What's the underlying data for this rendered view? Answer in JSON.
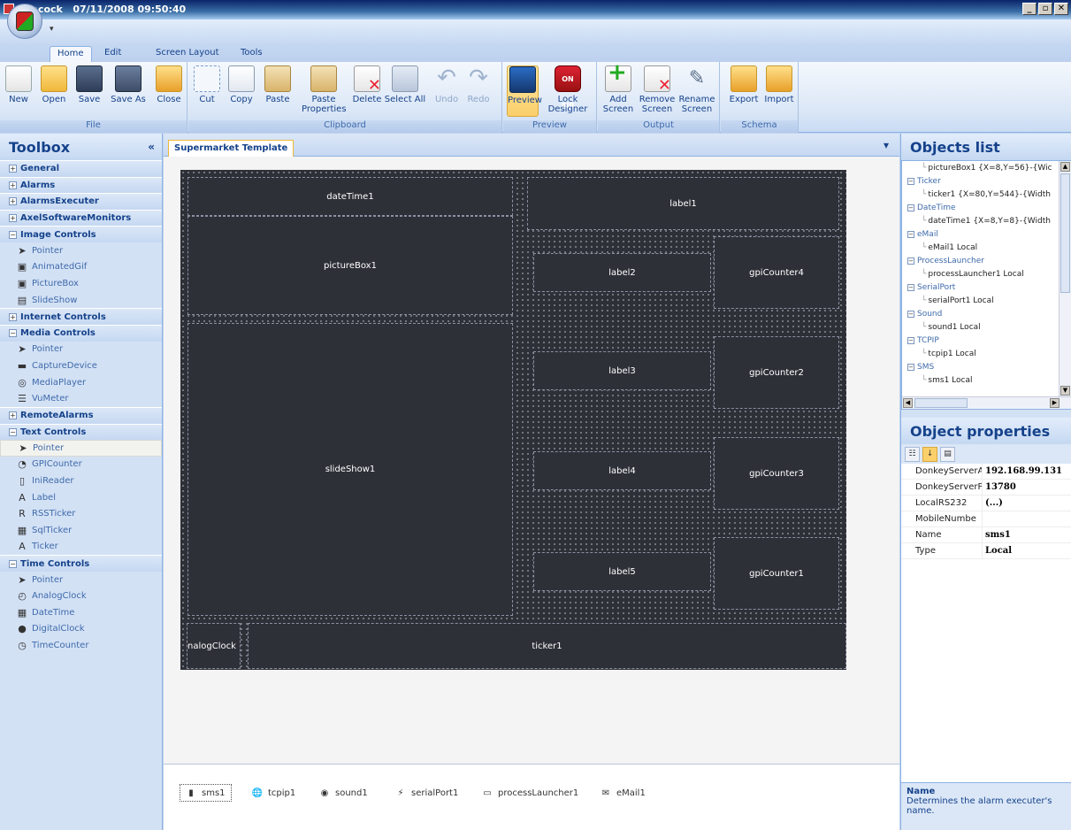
{
  "window": {
    "title": "Peacock   07/11/2008 09:50:40",
    "buttons": [
      "_",
      "▫",
      "✕"
    ]
  },
  "quick_access": "▾",
  "tabs": [
    "Home",
    "Edit",
    "Screen Layout",
    "Tools"
  ],
  "ribbon": {
    "groups": {
      "file": "File",
      "clipboard": "Clipboard",
      "preview": "Preview",
      "output": "Output",
      "schema": "Schema"
    },
    "buttons": {
      "new": "New",
      "open": "Open",
      "save": "Save",
      "save_as": "Save As",
      "close": "Close",
      "cut": "Cut",
      "copy": "Copy",
      "paste": "Paste",
      "paste_properties": "Paste\nProperties",
      "delete": "Delete",
      "select_all": "Select All",
      "undo": "Undo",
      "redo": "Redo",
      "preview": "Preview",
      "lock_designer": "Lock\nDesigner",
      "lock_icon_text": "ON AIR",
      "add_screen": "Add\nScreen",
      "remove_screen": "Remove\nScreen",
      "rename_screen": "Rename\nScreen",
      "export": "Export",
      "import": "Import"
    }
  },
  "toolbox": {
    "title": "Toolbox",
    "collapse_glyph": "«",
    "rows": [
      {
        "type": "cat",
        "label": "General",
        "expanded": false
      },
      {
        "type": "cat",
        "label": "Alarms",
        "expanded": false
      },
      {
        "type": "cat",
        "label": "AlarmsExecuter",
        "expanded": false
      },
      {
        "type": "cat",
        "label": "AxelSoftwareMonitors",
        "expanded": false
      },
      {
        "type": "cat",
        "label": "Image Controls",
        "expanded": true
      },
      {
        "type": "item",
        "label": "Pointer",
        "icon": "pointer-icon"
      },
      {
        "type": "item",
        "label": "AnimatedGif",
        "icon": "image-icon"
      },
      {
        "type": "item",
        "label": "PictureBox",
        "icon": "image-icon"
      },
      {
        "type": "item",
        "label": "SlideShow",
        "icon": "slideshow-icon"
      },
      {
        "type": "cat",
        "label": "Internet Controls",
        "expanded": false
      },
      {
        "type": "cat",
        "label": "Media Controls",
        "expanded": true
      },
      {
        "type": "item",
        "label": "Pointer",
        "icon": "pointer-icon"
      },
      {
        "type": "item",
        "label": "CaptureDevice",
        "icon": "capture-icon"
      },
      {
        "type": "item",
        "label": "MediaPlayer",
        "icon": "media-player-icon"
      },
      {
        "type": "item",
        "label": "VuMeter",
        "icon": "vumeter-icon"
      },
      {
        "type": "cat",
        "label": "RemoteAlarms",
        "expanded": false
      },
      {
        "type": "cat",
        "label": "Text Controls",
        "expanded": true
      },
      {
        "type": "item",
        "label": "Pointer",
        "icon": "pointer-icon",
        "selected": true
      },
      {
        "type": "item",
        "label": "GPICounter",
        "icon": "counter-icon"
      },
      {
        "type": "item",
        "label": "IniReader",
        "icon": "ini-icon"
      },
      {
        "type": "item",
        "label": "Label",
        "icon": "label-icon"
      },
      {
        "type": "item",
        "label": "RSSTicker",
        "icon": "rss-icon"
      },
      {
        "type": "item",
        "label": "SqlTicker",
        "icon": "sql-icon"
      },
      {
        "type": "item",
        "label": "Ticker",
        "icon": "ticker-icon"
      },
      {
        "type": "cat",
        "label": "Time Controls",
        "expanded": true
      },
      {
        "type": "item",
        "label": "Pointer",
        "icon": "pointer-icon"
      },
      {
        "type": "item",
        "label": "AnalogClock",
        "icon": "analog-clock-icon"
      },
      {
        "type": "item",
        "label": "DateTime",
        "icon": "calendar-icon"
      },
      {
        "type": "item",
        "label": "DigitalClock",
        "icon": "digital-clock-icon"
      },
      {
        "type": "item",
        "label": "TimeCounter",
        "icon": "stopwatch-icon"
      }
    ]
  },
  "designer": {
    "tab": "Supermarket Template",
    "dropdown": "▾",
    "controls": {
      "dateTime1": "dateTime1",
      "label1": "label1",
      "pictureBox1": "pictureBox1",
      "label2": "label2",
      "gpiCounter4": "gpiCounter4",
      "slideShow1": "slideShow1",
      "label3": "label3",
      "gpiCounter2": "gpiCounter2",
      "label4": "label4",
      "gpiCounter3": "gpiCounter3",
      "label5": "label5",
      "gpiCounter1": "gpiCounter1",
      "analogClock": "nalogClock",
      "ticker1": "ticker1"
    },
    "components": [
      "sms1",
      "tcpip1",
      "sound1",
      "serialPort1",
      "processLauncher1",
      "eMail1"
    ]
  },
  "objects_list": {
    "title": "Objects list",
    "rows": [
      {
        "type": "child",
        "label": "pictureBox1  {X=8,Y=56}-{Wic"
      },
      {
        "type": "cat",
        "label": "Ticker"
      },
      {
        "type": "child",
        "label": "ticker1  {X=80,Y=544}-{Width"
      },
      {
        "type": "cat",
        "label": "DateTime"
      },
      {
        "type": "child",
        "label": "dateTime1  {X=8,Y=8}-{Width"
      },
      {
        "type": "cat",
        "label": "eMail"
      },
      {
        "type": "child",
        "label": "eMail1  Local"
      },
      {
        "type": "cat",
        "label": "ProcessLauncher"
      },
      {
        "type": "child",
        "label": "processLauncher1  Local"
      },
      {
        "type": "cat",
        "label": "SerialPort"
      },
      {
        "type": "child",
        "label": "serialPort1  Local"
      },
      {
        "type": "cat",
        "label": "Sound"
      },
      {
        "type": "child",
        "label": "sound1  Local"
      },
      {
        "type": "cat",
        "label": "TCPIP"
      },
      {
        "type": "child",
        "label": "tcpip1  Local"
      },
      {
        "type": "cat",
        "label": "SMS"
      },
      {
        "type": "child",
        "label": "sms1  Local"
      }
    ]
  },
  "object_properties": {
    "title": "Object properties",
    "rows": [
      {
        "key": "DonkeyServerA",
        "value": "192.168.99.131"
      },
      {
        "key": "DonkeyServerP",
        "value": "13780"
      },
      {
        "key": "LocalRS232",
        "value": "(...)"
      },
      {
        "key": "MobileNumbe",
        "value": ""
      },
      {
        "key": "Name",
        "value": "sms1"
      },
      {
        "key": "Type",
        "value": "Local"
      }
    ],
    "help_name": "Name",
    "help_text": "Determines the alarm executer's name."
  }
}
